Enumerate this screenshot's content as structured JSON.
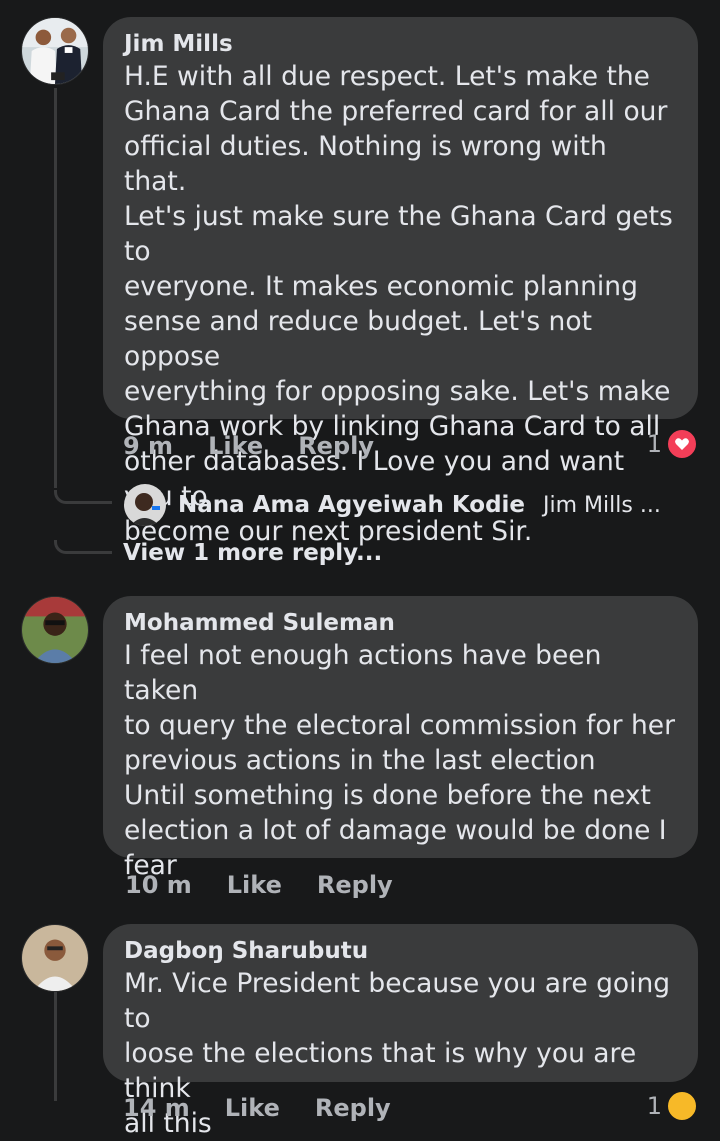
{
  "comments": [
    {
      "author": "Jim Mills",
      "text": "H.E with all due respect. Let's make the\nGhana Card the preferred card for all our\nofficial duties. Nothing is wrong with that.\nLet's just make sure the Ghana Card gets to\neveryone. It makes economic planning\nsense and reduce budget. Let's not oppose\neverything for opposing sake. Let's make\nGhana work by linking Ghana Card to all\nother databases. I Love you and want you to\nbecome our next president Sir.",
      "time": "9 m",
      "like_label": "Like",
      "reply_label": "Reply",
      "reaction_count": "1",
      "reaction_icon": "heart-icon"
    },
    {
      "author": "Mohammed Suleman",
      "text": "I feel not enough actions have been taken\nto query the electoral commission for her\nprevious actions in the last election\nUntil something is done before the next\nelection a lot of damage would be done I\nfear",
      "time": "10 m",
      "like_label": "Like",
      "reply_label": "Reply"
    },
    {
      "author": "Dagboŋ Sharubutu",
      "text": "Mr. Vice President because you are going to\nloose the elections that is why you are think\nall this",
      "time": "14 m",
      "like_label": "Like",
      "reply_label": "Reply",
      "reaction_count": "1",
      "reaction_icon": "haha-icon"
    }
  ],
  "reply_preview": {
    "author": "Nana Ama Agyeiwah Kodie",
    "snippet": "Jim Mills ..."
  },
  "view_more_label": "View 1 more reply...",
  "colors": {
    "background": "#18191a",
    "bubble": "#3a3b3c",
    "text": "#e4e6eb",
    "muted": "#b0b3b8",
    "heart": "#f33e58"
  }
}
